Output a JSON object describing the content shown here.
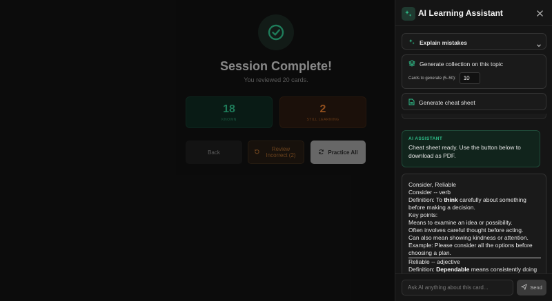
{
  "session": {
    "title": "Session Complete!",
    "subtitle": "You reviewed 20 cards.",
    "stats": {
      "known": {
        "value": "18",
        "label": "KNOWN"
      },
      "learning": {
        "value": "2",
        "label": "STILL LEARNING"
      }
    },
    "buttons": {
      "back": "Back",
      "review": "Review Incorrect (2)",
      "practice": "Practice All"
    }
  },
  "panel": {
    "title": "AI Learning Assistant",
    "tools": {
      "explain": "Explain mistakes",
      "collection": "Generate collection on this topic",
      "count_label": "Cards to generate (5–50):",
      "count_value": "10",
      "cheat": "Generate cheat sheet"
    },
    "ai_message": {
      "label": "AI ASSISTANT",
      "text": "Cheat sheet ready. Use the button below to download as PDF."
    },
    "sheet_lines": [
      "Consider, Reliable",
      "Consider -- verb",
      "Definition: To ",
      "think",
      " carefully about something before making a decision.",
      "Key points:",
      "Means to examine an idea or possibility.",
      "Often involves careful thought before acting.",
      "Can also mean showing kindness or attention.",
      "Example: Please consider all the options before choosing a plan.",
      "Reliable -- adjective",
      "Definition: ",
      "Dependable",
      " means consistently doing"
    ],
    "composer": {
      "placeholder": "Ask AI anything about this card...",
      "send": "Send"
    }
  },
  "colors": {
    "accent": "#2fbf8a",
    "warning": "#e07a2e",
    "panel_bg": "#151515"
  }
}
